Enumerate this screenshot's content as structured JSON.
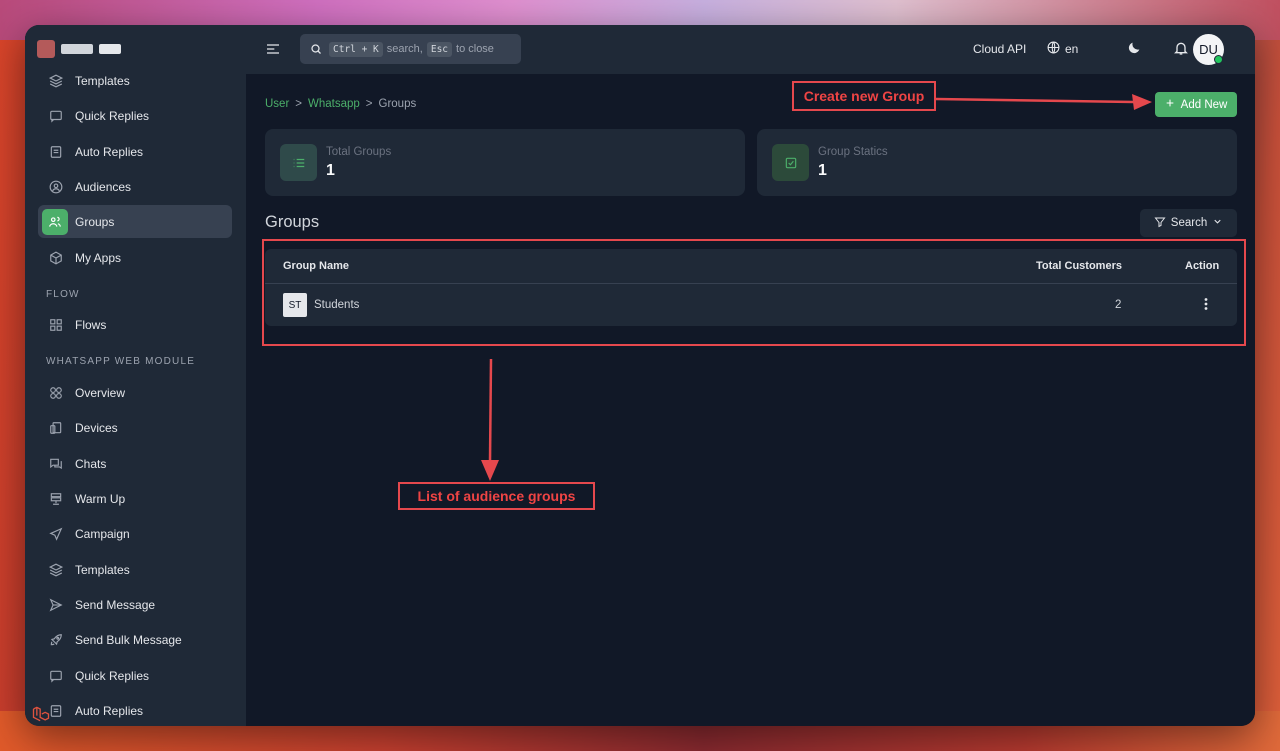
{
  "sidebar": {
    "items": [
      {
        "label": "Templates",
        "icon": "layers-icon"
      },
      {
        "label": "Quick Replies",
        "icon": "message-square-icon"
      },
      {
        "label": "Auto Replies",
        "icon": "file-text-icon"
      },
      {
        "label": "Audiences",
        "icon": "user-circle-icon"
      },
      {
        "label": "Groups",
        "icon": "users-icon",
        "active": true
      },
      {
        "label": "My Apps",
        "icon": "box-icon"
      }
    ],
    "section_flow": "FLOW",
    "flow_items": [
      {
        "label": "Flows",
        "icon": "grid-icon"
      }
    ],
    "section_web": "WHATSAPP WEB MODULE",
    "web_items": [
      {
        "label": "Overview",
        "icon": "circles-icon"
      },
      {
        "label": "Devices",
        "icon": "devices-icon"
      },
      {
        "label": "Chats",
        "icon": "chats-icon"
      },
      {
        "label": "Warm Up",
        "icon": "server-icon"
      },
      {
        "label": "Campaign",
        "icon": "send-nav-icon"
      },
      {
        "label": "Templates",
        "icon": "layers-icon"
      },
      {
        "label": "Send Message",
        "icon": "send-icon"
      },
      {
        "label": "Send Bulk Message",
        "icon": "rocket-icon"
      },
      {
        "label": "Quick Replies",
        "icon": "message-square-icon"
      },
      {
        "label": "Auto Replies",
        "icon": "file-text-icon"
      }
    ]
  },
  "topbar": {
    "search_kbd1": "Ctrl + K",
    "search_mid": "search,",
    "search_kbd2": "Esc",
    "search_end": "to close",
    "cloud_api": "Cloud API",
    "lang": "en",
    "avatar": "DU"
  },
  "breadcrumb": {
    "user": "User",
    "sep1": ">",
    "whatsapp": "Whatsapp",
    "sep2": ">",
    "current": "Groups"
  },
  "add_button": "Add New",
  "stats": [
    {
      "label": "Total Groups",
      "value": "1"
    },
    {
      "label": "Group Statics",
      "value": "1"
    }
  ],
  "section_title": "Groups",
  "filter_button": "Search",
  "table": {
    "headers": {
      "name": "Group Name",
      "customers": "Total Customers",
      "action": "Action"
    },
    "rows": [
      {
        "badge": "ST",
        "name": "Students",
        "customers": "2"
      }
    ]
  },
  "annotations": {
    "create": "Create new Group",
    "list": "List of audience groups"
  },
  "colors": {
    "accent": "#4caf6a",
    "annotation": "#e5484d",
    "bg": "#111827",
    "panel": "#1f2937"
  }
}
